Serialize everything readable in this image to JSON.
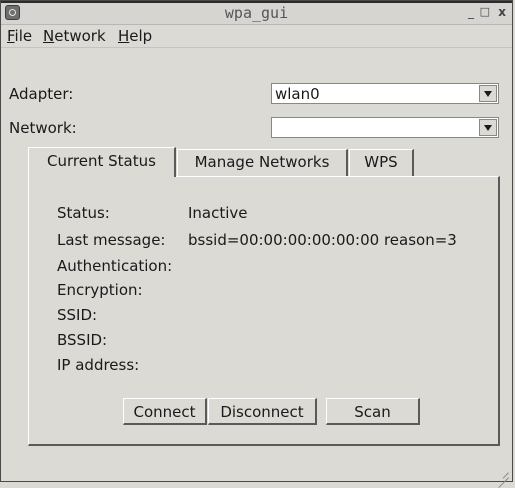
{
  "window": {
    "title": "wpa_gui",
    "controls": {
      "minimize": "_",
      "maximize": "□",
      "close": "x"
    }
  },
  "menubar": {
    "file": {
      "mnemonic": "F",
      "rest": "ile"
    },
    "network": {
      "mnemonic": "N",
      "rest": "etwork"
    },
    "help": {
      "mnemonic": "H",
      "rest": "elp"
    }
  },
  "adapter": {
    "label": "Adapter:",
    "value": "wlan0"
  },
  "network": {
    "label": "Network:",
    "value": ""
  },
  "tabs": [
    {
      "label": "Current Status",
      "active": true
    },
    {
      "label": "Manage Networks",
      "active": false
    },
    {
      "label": "WPS",
      "active": false
    }
  ],
  "status": {
    "rows": [
      {
        "label": "Status:",
        "value": "Inactive"
      },
      {
        "label": "Last message:",
        "value": "bssid=00:00:00:00:00:00 reason=3"
      },
      {
        "label": "Authentication:",
        "value": ""
      },
      {
        "label": "Encryption:",
        "value": ""
      },
      {
        "label": "SSID:",
        "value": ""
      },
      {
        "label": "BSSID:",
        "value": ""
      },
      {
        "label": "IP address:",
        "value": ""
      }
    ]
  },
  "buttons": {
    "connect": "Connect",
    "disconnect": "Disconnect",
    "scan": "Scan"
  },
  "colors": {
    "background": "#dcdad5",
    "field": "#ffffff",
    "text": "#1a1a1a"
  },
  "icons": [
    "app-icon",
    "dropdown-arrow-icon",
    "resize-grip-icon"
  ]
}
